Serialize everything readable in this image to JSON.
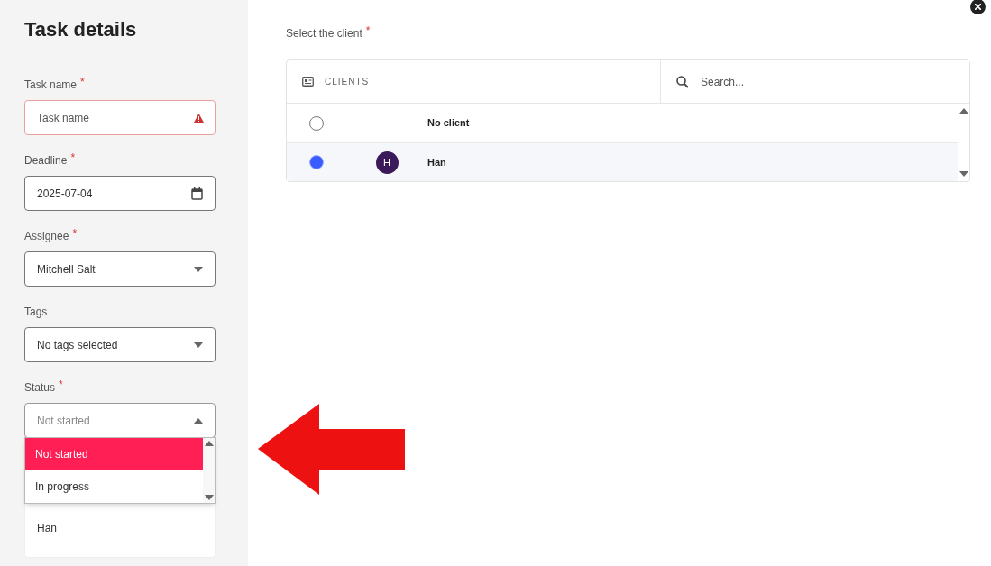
{
  "sidebar": {
    "title": "Task details",
    "fields": [
      {
        "kind": "text",
        "label": "Task name",
        "required_mark": "*",
        "placeholder": "Task name",
        "error": true
      },
      {
        "kind": "date",
        "label": "Deadline",
        "required_mark": "*",
        "value": "2025-07-04"
      },
      {
        "kind": "select",
        "label": "Assignee",
        "required_mark": "*",
        "value": "Mitchell Salt"
      },
      {
        "kind": "select",
        "label": "Tags",
        "value": "No tags selected"
      },
      {
        "kind": "select",
        "label": "Status",
        "required_mark": "*",
        "value": "Not started",
        "expanded": true,
        "options": [
          {
            "label": "Not started",
            "selected": true
          },
          {
            "label": "In progress",
            "selected": false
          }
        ]
      }
    ],
    "client_card": {
      "value": "Han"
    }
  },
  "client_picker": {
    "label": "Select the client",
    "required_mark": "*",
    "header": "CLIENTS",
    "search_placeholder": "Search...",
    "rows": [
      {
        "name": "No client",
        "selected": false
      },
      {
        "name": "Han",
        "initial": "H",
        "selected": true
      }
    ]
  }
}
